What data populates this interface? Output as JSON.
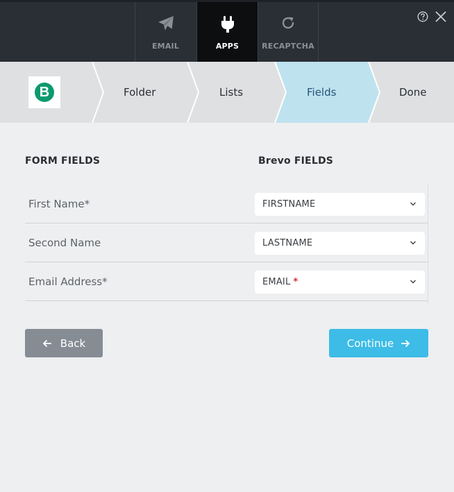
{
  "top_tabs": [
    {
      "label": "EMAIL",
      "icon": "paper-plane-icon",
      "active": false
    },
    {
      "label": "APPS",
      "icon": "plug-icon",
      "active": true
    },
    {
      "label": "RECAPTCHA",
      "icon": "refresh-icon",
      "active": false
    }
  ],
  "header_icons": {
    "help": "help-icon",
    "close": "close-icon"
  },
  "stepper": {
    "logo_letter": "B",
    "steps": [
      "Folder",
      "Lists",
      "Fields",
      "Done"
    ],
    "active_step": "Fields",
    "colors": {
      "active": "#bfe2ef",
      "inactive": "#dfe0e2"
    }
  },
  "columns": {
    "form": "FORM FIELDS",
    "brevo": "Brevo FIELDS"
  },
  "rows": [
    {
      "label": "First Name*",
      "value": "FIRSTNAME",
      "required": false
    },
    {
      "label": "Second Name",
      "value": "LASTNAME",
      "required": false
    },
    {
      "label": "Email Address*",
      "value": "EMAIL",
      "required": true,
      "required_mark": "*"
    }
  ],
  "buttons": {
    "back": "Back",
    "continue": "Continue"
  },
  "colors": {
    "accent": "#3cbce6",
    "back": "#858c94",
    "brevo_green": "#0b996e"
  }
}
